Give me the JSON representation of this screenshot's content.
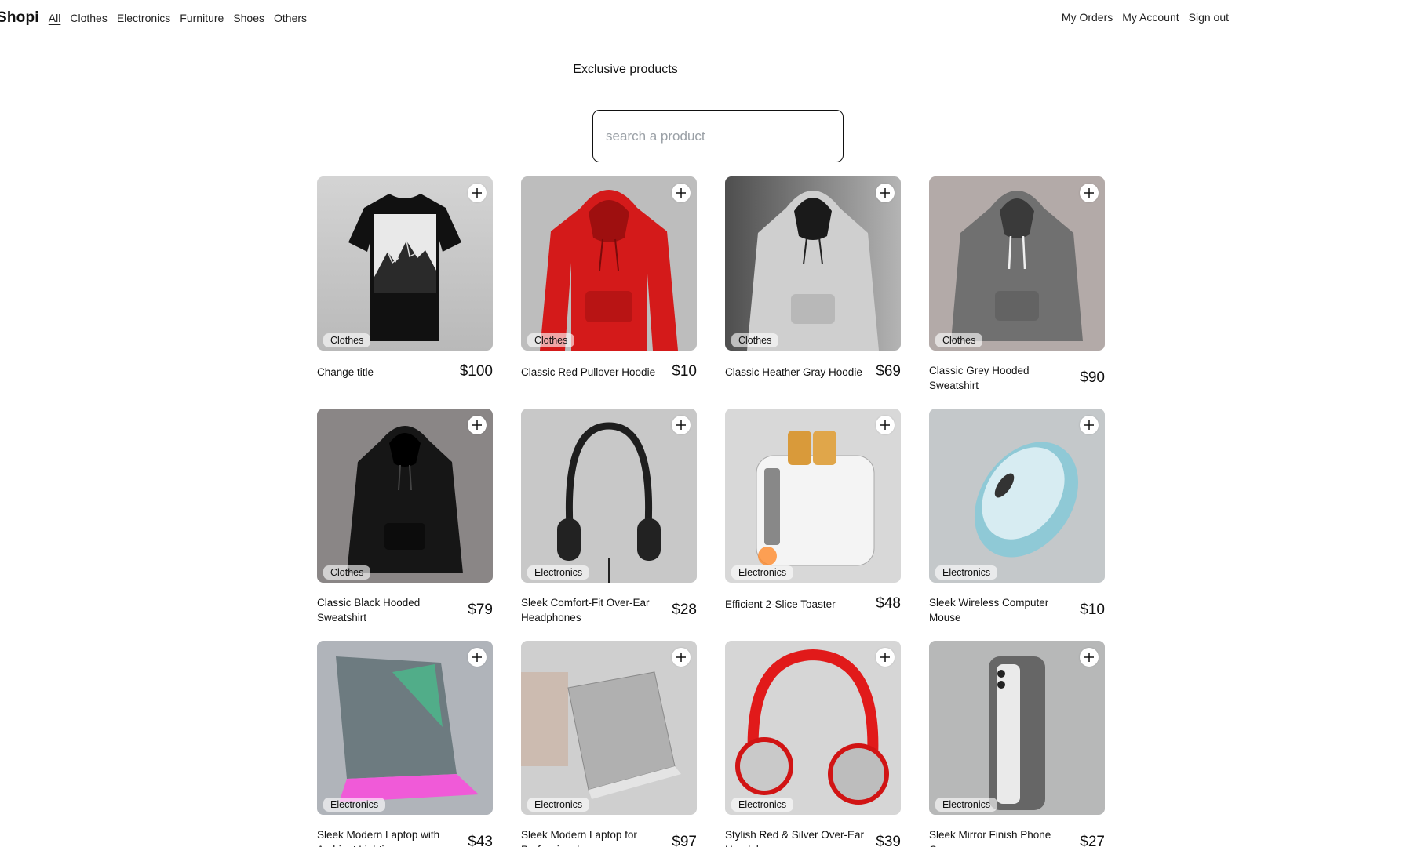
{
  "brand": "Shopi",
  "nav": {
    "categories": [
      "All",
      "Clothes",
      "Electronics",
      "Furniture",
      "Shoes",
      "Others"
    ],
    "account": [
      "My Orders",
      "My Account",
      "Sign out"
    ]
  },
  "page_title": "Exclusive products",
  "search": {
    "placeholder": "search a product",
    "value": ""
  },
  "products": [
    {
      "name": "Change title",
      "price": "$100",
      "category": "Clothes",
      "image": "black-tshirt-mountains"
    },
    {
      "name": "Classic Red Pullover Hoodie",
      "price": "$10",
      "category": "Clothes",
      "image": "red-hoodie"
    },
    {
      "name": "Classic Heather Gray Hoodie",
      "price": "$69",
      "category": "Clothes",
      "image": "gray-hoodie"
    },
    {
      "name": "Classic Grey Hooded Sweatshirt",
      "price": "$90",
      "category": "Clothes",
      "image": "grey-hoodie"
    },
    {
      "name": "Classic Black Hooded Sweatshirt",
      "price": "$79",
      "category": "Clothes",
      "image": "black-hoodie"
    },
    {
      "name": "Sleek Comfort-Fit Over-Ear Headphones",
      "price": "$28",
      "category": "Electronics",
      "image": "black-headphones"
    },
    {
      "name": "Efficient 2-Slice Toaster",
      "price": "$48",
      "category": "Electronics",
      "image": "toaster"
    },
    {
      "name": "Sleek Wireless Computer Mouse",
      "price": "$10",
      "category": "Electronics",
      "image": "mouse"
    },
    {
      "name": "Sleek Modern Laptop with Ambient Lighting",
      "price": "$43",
      "category": "Electronics",
      "image": "laptop-glow"
    },
    {
      "name": "Sleek Modern Laptop for Professionals",
      "price": "$97",
      "category": "Electronics",
      "image": "laptop-silver"
    },
    {
      "name": "Stylish Red & Silver Over-Ear Headphones",
      "price": "$39",
      "category": "Electronics",
      "image": "red-headphones"
    },
    {
      "name": "Sleek Mirror Finish Phone Case",
      "price": "$27",
      "category": "Electronics",
      "image": "phone-case"
    }
  ]
}
